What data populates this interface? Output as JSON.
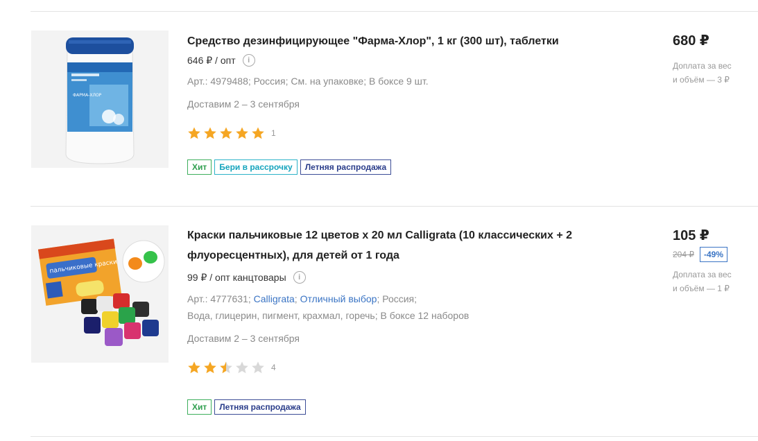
{
  "products": [
    {
      "title": "Средство дезинфицирующее \"Фарма-Хлор\", 1 кг (300 шт), таблетки",
      "title_line2": "",
      "opt_price": "646 ₽ / опт",
      "details": [
        {
          "text": "Арт.: 4979488",
          "link": false
        },
        {
          "text": "Россия",
          "link": false
        },
        {
          "text": "См. на упаковке",
          "link": false
        },
        {
          "text": "В боксе 9 шт.",
          "link": false
        }
      ],
      "details2": [],
      "delivery": "Доставим 2 – 3 сентября",
      "rating": 5,
      "rating_count": "1",
      "badges": [
        {
          "label": "Хит",
          "type": "hit"
        },
        {
          "label": "Бери в рассрочку",
          "type": "ras"
        },
        {
          "label": "Летняя распродажа",
          "type": "sale"
        }
      ],
      "price": "680 ₽",
      "old_price": "",
      "discount": "",
      "extra_line1": "Доплата за вес",
      "extra_line2": "и объём — 3 ₽",
      "image_label": "ФАРМА-ХЛОР"
    },
    {
      "title": "Краски пальчиковые 12 цветов х 20 мл Calligrata (10 классических + 2",
      "title_line2": "флуоресцентных), для детей от 1 года",
      "opt_price": "99 ₽ / опт канцтовары",
      "details": [
        {
          "text": "Арт.: 4777631",
          "link": false
        },
        {
          "text": "Calligrata",
          "link": true
        },
        {
          "text": "Отличный выбор",
          "link": true
        },
        {
          "text": "Россия",
          "link": false
        }
      ],
      "details2": [
        {
          "text": "Вода, глицерин, пигмент, крахмал, горечь",
          "link": false
        },
        {
          "text": "В боксе 12 наборов",
          "link": false
        }
      ],
      "delivery": "Доставим 2 – 3 сентября",
      "rating": 2.5,
      "rating_count": "4",
      "badges": [
        {
          "label": "Хит",
          "type": "hit"
        },
        {
          "label": "Летняя распродажа",
          "type": "sale"
        }
      ],
      "price": "105 ₽",
      "old_price": "204 ₽",
      "discount": "-49%",
      "extra_line1": "Доплата за вес",
      "extra_line2": "и объём — 1 ₽",
      "image_label": "пальчиковые краски"
    }
  ],
  "colors": {
    "star": "#f5a623",
    "star_empty": "#d8d8d8",
    "link": "#3a74c4"
  }
}
